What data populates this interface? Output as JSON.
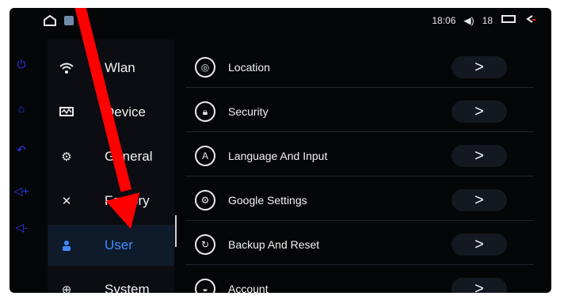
{
  "statusbar": {
    "time": "18:06",
    "volume_icon": "speaker-icon",
    "volume_level": "18",
    "window_icon": "recent-apps-icon",
    "back_icon": "back-icon"
  },
  "navbar": {
    "items": [
      {
        "name": "power-icon"
      },
      {
        "name": "home-icon"
      },
      {
        "name": "back-icon"
      },
      {
        "name": "volume-up-icon"
      },
      {
        "name": "volume-down-icon"
      }
    ]
  },
  "sidebar": {
    "items": [
      {
        "label": "Wlan",
        "icon": "wifi-icon"
      },
      {
        "label": "Device",
        "icon": "monitor-icon"
      },
      {
        "label": "General",
        "icon": "gear-icon"
      },
      {
        "label": "Factory",
        "icon": "tools-icon"
      },
      {
        "label": "User",
        "icon": "user-icon",
        "active": true
      },
      {
        "label": "System",
        "icon": "globe-icon"
      }
    ]
  },
  "settings": {
    "items": [
      {
        "label": "Location",
        "icon": "location-icon"
      },
      {
        "label": "Security",
        "icon": "lock-icon"
      },
      {
        "label": "Language And Input",
        "icon": "keyboard-icon"
      },
      {
        "label": "Google Settings",
        "icon": "gear-icon"
      },
      {
        "label": "Backup And Reset",
        "icon": "reset-icon"
      },
      {
        "label": "Account",
        "icon": "account-icon"
      }
    ],
    "chevron": ">"
  },
  "colors": {
    "background": "#050608",
    "active": "#3e8cff",
    "annotation_arrow": "#ff0000",
    "nav_icons": "#2d3cff"
  }
}
